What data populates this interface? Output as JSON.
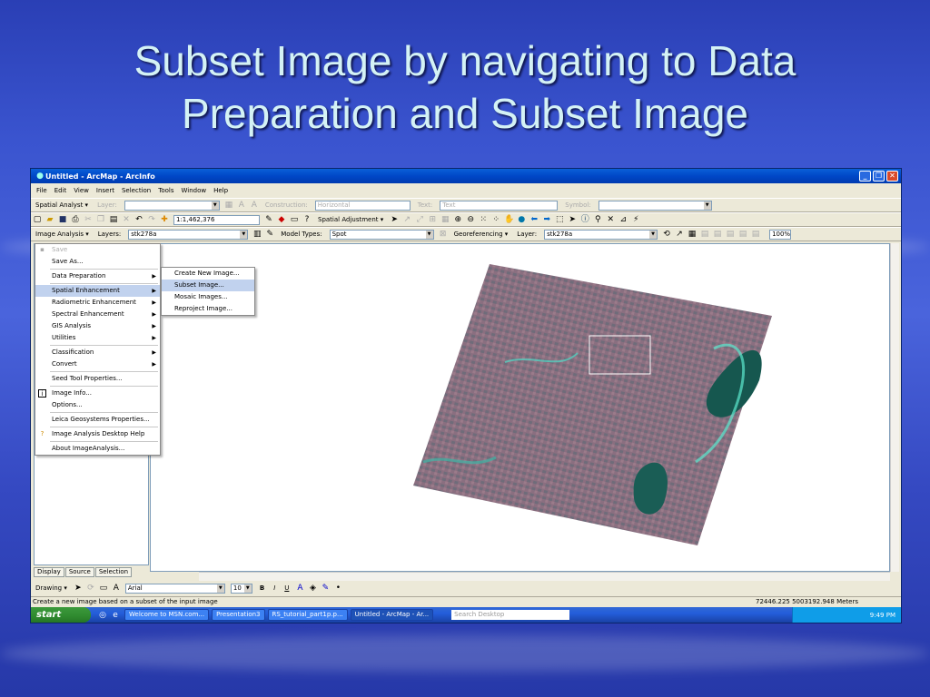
{
  "slide": {
    "title_line1": "Subset Image by navigating to Data",
    "title_line2": "Preparation and  Subset Image"
  },
  "window": {
    "title": "Untitled - ArcMap - ArcInfo",
    "minimize": "_",
    "maximize": "❐",
    "close": "✕"
  },
  "menubar": [
    "File",
    "Edit",
    "View",
    "Insert",
    "Selection",
    "Tools",
    "Window",
    "Help"
  ],
  "toolbar1": {
    "spatial_analyst": "Spatial Analyst ▾",
    "layer_label": "Layer:",
    "construction_label": "Construction:",
    "construction_value": "Horizontal",
    "text_label": "Text:",
    "text_value": "Text",
    "symbol_label": "Symbol:"
  },
  "toolbar2": {
    "scale": "1:1,462,376",
    "spatial_adjustment": "Spatial Adjustment ▾"
  },
  "toolbar3": {
    "image_analysis": "Image Analysis ▾",
    "layers_label": "Layers:",
    "layers_value": "stk278a",
    "model_types_label": "Model Types:",
    "model_types_value": "Spot",
    "georeferencing": "Georeferencing ▾",
    "layer_label": "Layer:",
    "layer_value": "stk278a",
    "zoom_value": "100%"
  },
  "image_analysis_menu": {
    "items": [
      {
        "label": "Save",
        "disabled": true
      },
      {
        "label": "Save As..."
      },
      {
        "label": "Data Preparation",
        "submenu": true
      },
      {
        "label": "Spatial Enhancement",
        "submenu": true
      },
      {
        "label": "Radiometric Enhancement",
        "submenu": true
      },
      {
        "label": "Spectral Enhancement",
        "submenu": true
      },
      {
        "label": "GIS Analysis",
        "submenu": true
      },
      {
        "label": "Utilities",
        "submenu": true
      },
      {
        "label": "Classification",
        "submenu": true
      },
      {
        "label": "Convert",
        "submenu": true
      },
      {
        "label": "Seed Tool Properties..."
      },
      {
        "label": "Image Info..."
      },
      {
        "label": "Options..."
      },
      {
        "label": "Leica Geosystems Properties..."
      },
      {
        "label": "Image Analysis Desktop Help"
      },
      {
        "label": "About ImageAnalysis..."
      }
    ]
  },
  "data_prep_submenu": {
    "items": [
      "Create New Image...",
      "Subset Image...",
      "Mosaic Images...",
      "Reproject Image..."
    ],
    "selected_index": 1
  },
  "toc_tabs": [
    "Display",
    "Source",
    "Selection"
  ],
  "drawbar": {
    "drawing": "Drawing ▾",
    "font": "Arial",
    "size": "10",
    "bold": "B",
    "italic": "I",
    "underline": "U"
  },
  "status": {
    "message": "Create a new image based on a subset of the input image",
    "coords": "72446.225  5003192.948 Meters"
  },
  "taskbar": {
    "start": "start",
    "tasks": [
      "Welcome to MSN.com...",
      "Presentation3",
      "RS_tutorial_part1p.p...",
      "Untitled - ArcMap - Ar..."
    ],
    "search_placeholder": "Search Desktop",
    "clock": "9:49 PM"
  }
}
